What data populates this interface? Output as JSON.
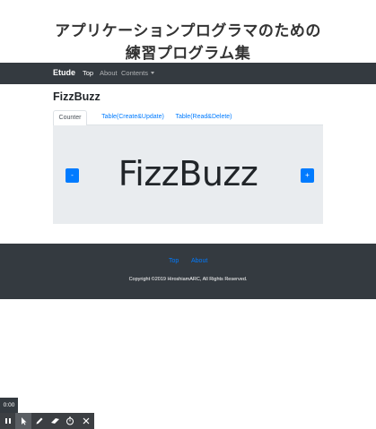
{
  "header": {
    "line1": "アプリケーションプログラマのための",
    "line2": "練習プログラム集"
  },
  "navbar": {
    "brand": "Etude",
    "items": [
      {
        "label": "Top",
        "active": true
      },
      {
        "label": "About",
        "active": false
      },
      {
        "label": "Contents",
        "active": false
      }
    ]
  },
  "main": {
    "title": "FizzBuzz",
    "tabs": [
      {
        "label": "Counter",
        "active": true
      },
      {
        "label": "Table(Create&Update)",
        "active": false
      },
      {
        "label": "Table(Read&Delete)",
        "active": false
      }
    ],
    "counter": {
      "decrement_label": "-",
      "increment_label": "+",
      "display_value": "FizzBuzz"
    }
  },
  "footer": {
    "links": [
      "Top",
      "About"
    ],
    "copyright": "Copyright ©2019 HiroshiamARC, All Rights Reserved."
  },
  "recorder": {
    "time": "0:00",
    "tools": [
      "pause-icon",
      "cursor-icon",
      "pen-icon",
      "highlighter-icon",
      "timer-icon",
      "close-icon"
    ]
  },
  "colors": {
    "navbar_bg": "#343a40",
    "primary": "#007bff",
    "pane_bg": "#e9ecef"
  }
}
